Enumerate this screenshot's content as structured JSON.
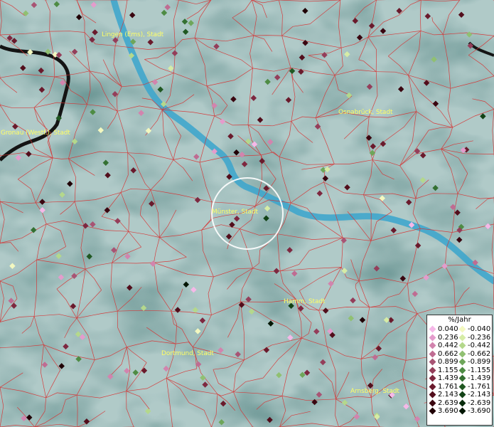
{
  "map": {
    "cities": [
      {
        "name": "Lingen (Ems), Stadt"
      },
      {
        "name": "Osnabrück, Stadt"
      },
      {
        "name": "Gronau (Westf.), Stadt"
      },
      {
        "name": "Münster, Stadt"
      },
      {
        "name": "Hamm, Stadt"
      },
      {
        "name": "Dortmund, Stadt"
      },
      {
        "name": "Arnsberg, Stadt"
      }
    ]
  },
  "legend": {
    "title": "%/Jahr",
    "positive": [
      {
        "label": "0.040",
        "color": "#f5b8e8"
      },
      {
        "label": "0.236",
        "color": "#e49ccc"
      },
      {
        "label": "0.442",
        "color": "#d284ae"
      },
      {
        "label": "0.662",
        "color": "#bf6c92"
      },
      {
        "label": "0.899",
        "color": "#a85474"
      },
      {
        "label": "1.155",
        "color": "#943e5a"
      },
      {
        "label": "1.439",
        "color": "#7e2840"
      },
      {
        "label": "1.761",
        "color": "#6a1a2c"
      },
      {
        "label": "2.143",
        "color": "#520e1c"
      },
      {
        "label": "2.639",
        "color": "#3a0610"
      },
      {
        "label": "3.690",
        "color": "#200006"
      }
    ],
    "negative": [
      {
        "label": "-0.040",
        "color": "#f3f8c0"
      },
      {
        "label": "-0.236",
        "color": "#d6eca6"
      },
      {
        "label": "-0.442",
        "color": "#b4d88c"
      },
      {
        "label": "-0.662",
        "color": "#90c072"
      },
      {
        "label": "-0.899",
        "color": "#6ea65a"
      },
      {
        "label": "-1.155",
        "color": "#4e8c44"
      },
      {
        "label": "-1.439",
        "color": "#347032"
      },
      {
        "label": "-1.761",
        "color": "#205822"
      },
      {
        "label": "-2.143",
        "color": "#124216"
      },
      {
        "label": "-2.639",
        "color": "#082c0c"
      },
      {
        "label": "-3.690",
        "color": "#021604"
      }
    ]
  },
  "colors": {
    "background": "#6f9a98",
    "borders": "#d83030",
    "river": "#3aa4cc",
    "state_border": "#141414",
    "highlight_circle": "#ffffff"
  }
}
